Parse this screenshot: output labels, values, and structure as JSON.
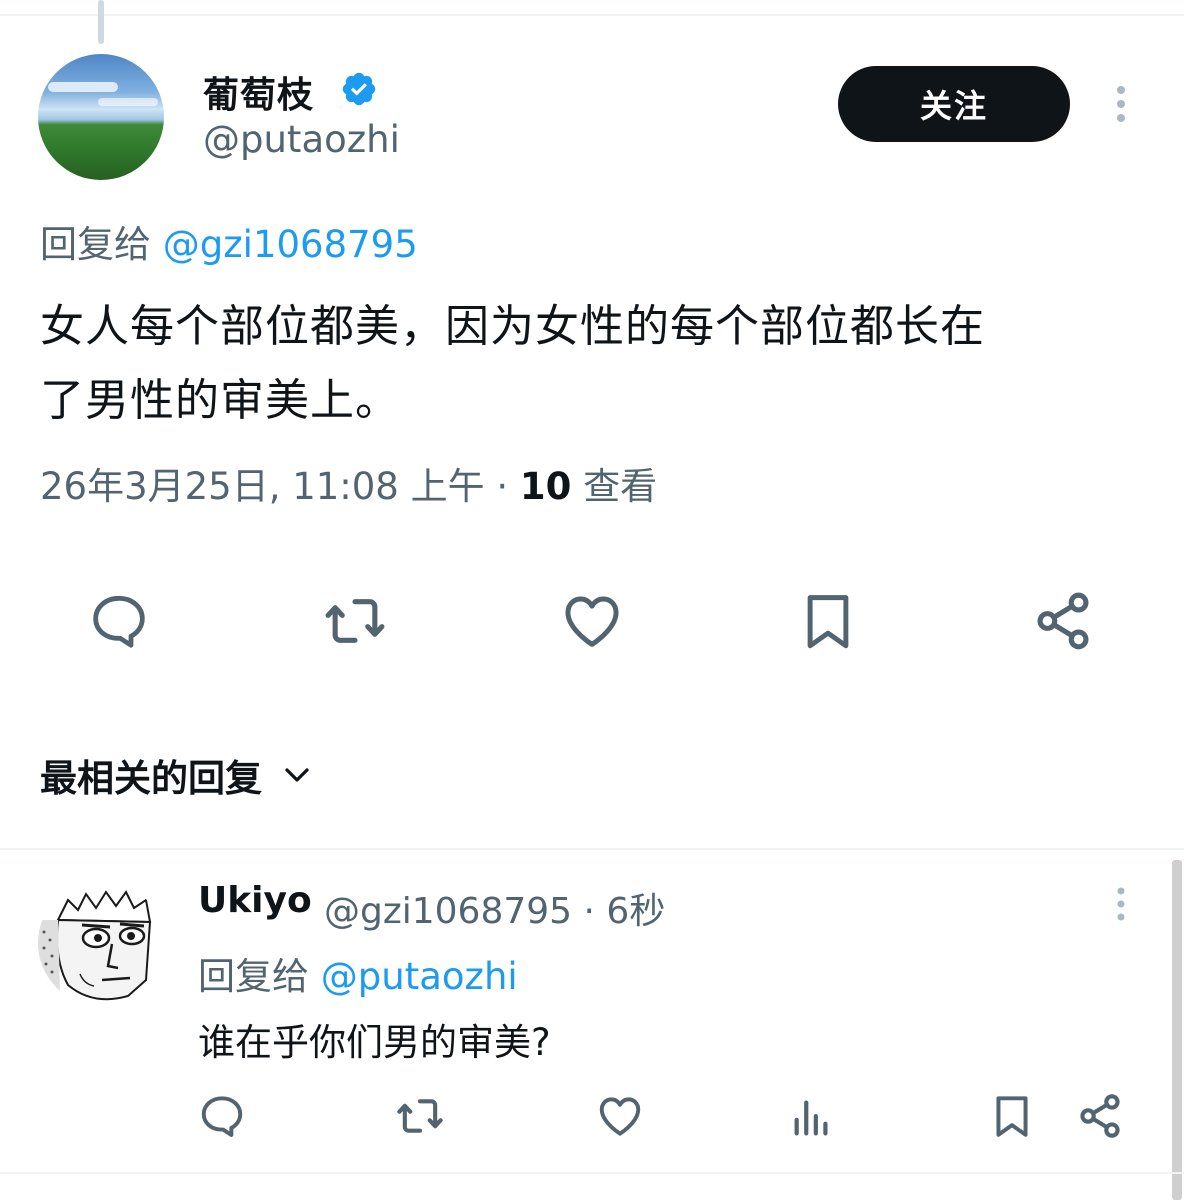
{
  "tweet": {
    "author_name": "葡萄枝",
    "author_handle": "@putaozhi",
    "follow_label": "关注",
    "reply_to_label": "回复给",
    "reply_to_handle": "@gzi1068795",
    "text_line1": "女人每个部位都美，因为女性的每个部位都长在",
    "text_line2": "了男性的审美上。",
    "timestamp": "26年3月25日, 11:08 上午",
    "separator": "·",
    "views_count": "10",
    "views_label": "查看",
    "actions": [
      "reply-icon",
      "retweet-icon",
      "like-icon",
      "bookmark-icon",
      "share-icon"
    ]
  },
  "replies_sort": {
    "label": "最相关的回复",
    "icon": "chevron-down-icon"
  },
  "reply": {
    "author_name": "Ukiyo",
    "author_handle": "@gzi1068795",
    "time": "· 6秒",
    "reply_to_label": "回复给",
    "reply_to_handle": "@putaozhi",
    "text": "谁在乎你们男的审美?",
    "actions": [
      "reply-icon",
      "retweet-icon",
      "like-icon",
      "views-icon",
      "bookmark-icon",
      "share-icon"
    ]
  },
  "colors": {
    "text_primary": "#0f1419",
    "text_secondary": "#536471",
    "link": "#1d9bf0",
    "verified": "#1d9bf0",
    "icon": "#536471"
  }
}
